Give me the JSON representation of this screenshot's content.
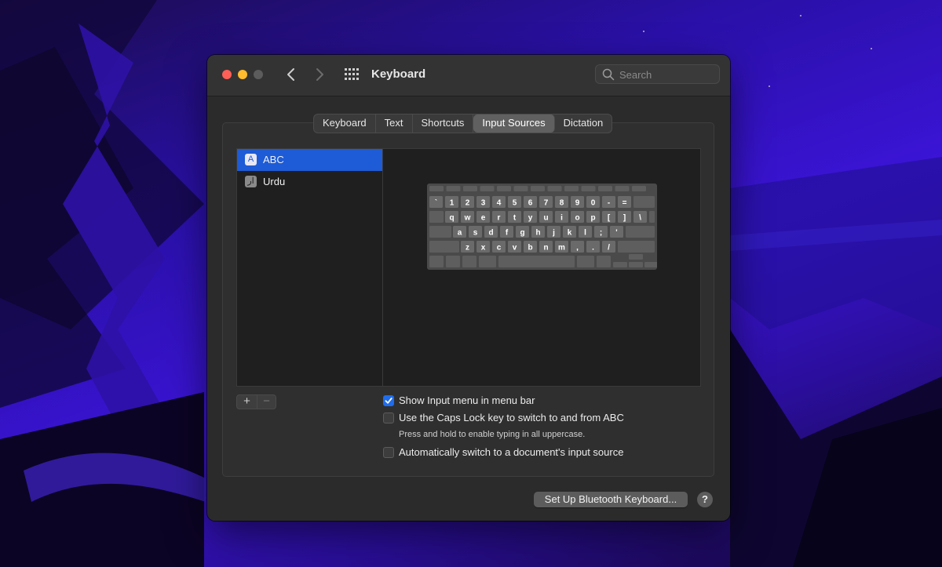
{
  "window": {
    "title": "Keyboard",
    "search_placeholder": "Search"
  },
  "tabs": [
    {
      "label": "Keyboard",
      "active": false
    },
    {
      "label": "Text",
      "active": false
    },
    {
      "label": "Shortcuts",
      "active": false
    },
    {
      "label": "Input Sources",
      "active": true
    },
    {
      "label": "Dictation",
      "active": false
    }
  ],
  "input_sources": [
    {
      "label": "ABC",
      "icon": "A",
      "selected": true
    },
    {
      "label": "Urdu",
      "icon": "ار",
      "selected": false
    }
  ],
  "list_controls": {
    "add": "+",
    "remove": "−"
  },
  "keyboard_rows": [
    [
      "`",
      "1",
      "2",
      "3",
      "4",
      "5",
      "6",
      "7",
      "8",
      "9",
      "0",
      "-",
      "="
    ],
    [
      "q",
      "w",
      "e",
      "r",
      "t",
      "y",
      "u",
      "i",
      "o",
      "p",
      "[",
      "]",
      "\\"
    ],
    [
      "a",
      "s",
      "d",
      "f",
      "g",
      "h",
      "j",
      "k",
      "l",
      ";",
      "'"
    ],
    [
      "z",
      "x",
      "c",
      "v",
      "b",
      "n",
      "m",
      ",",
      ".",
      "/"
    ]
  ],
  "options": {
    "show_input_menu": {
      "label": "Show Input menu in menu bar",
      "checked": true
    },
    "caps_lock_switch": {
      "label": "Use the Caps Lock key to switch to and from ABC",
      "checked": false
    },
    "caps_lock_hint": "Press and hold to enable typing in all uppercase.",
    "auto_switch": {
      "label": "Automatically switch to a document's input source",
      "checked": false
    }
  },
  "footer": {
    "bluetooth_button": "Set Up Bluetooth Keyboard...",
    "help_button": "?"
  }
}
